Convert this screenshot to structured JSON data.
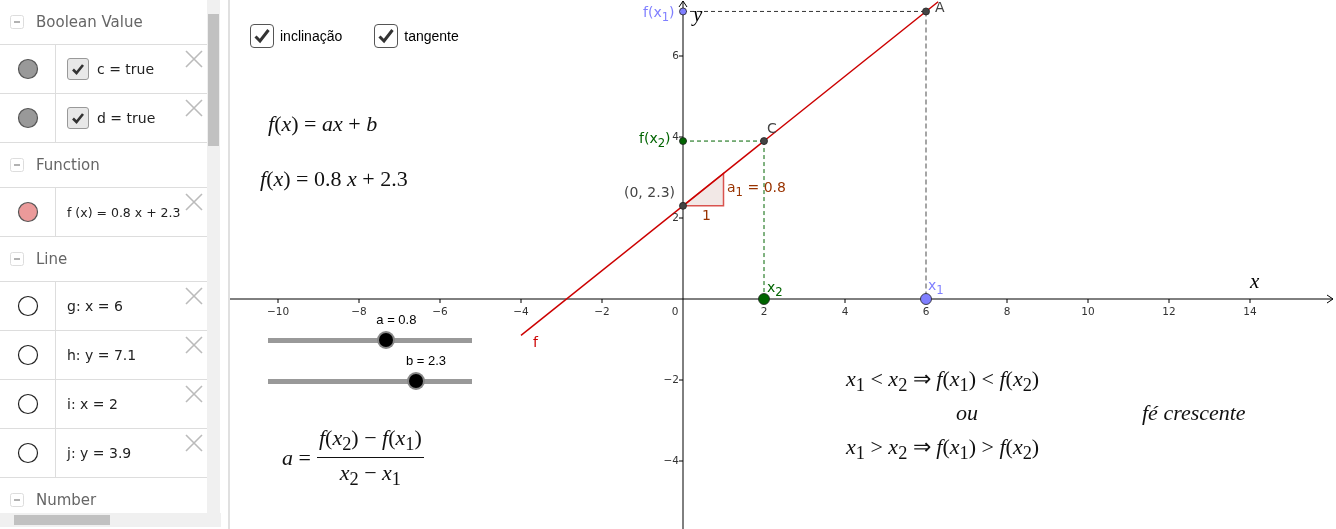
{
  "algebra_view": {
    "groups": [
      {
        "header": "Boolean Value",
        "expanded": true,
        "items": [
          {
            "kind": "checkbox",
            "visible": true,
            "color": "#999999",
            "checked": true,
            "text": "c = true"
          },
          {
            "kind": "checkbox",
            "visible": true,
            "color": "#999999",
            "checked": true,
            "text": "d = true"
          }
        ]
      },
      {
        "header": "Function",
        "expanded": true,
        "items": [
          {
            "kind": "text",
            "visible": true,
            "color": "#eb9a9a",
            "text": "f (x) = 0.8 x + 2.3"
          }
        ]
      },
      {
        "header": "Line",
        "expanded": true,
        "items": [
          {
            "kind": "text",
            "visible": false,
            "text": "g: x = 6"
          },
          {
            "kind": "text",
            "visible": false,
            "text": "h: y = 7.1"
          },
          {
            "kind": "text",
            "visible": false,
            "text": "i: x = 2"
          },
          {
            "kind": "text",
            "visible": false,
            "text": "j: y = 3.9"
          }
        ]
      },
      {
        "header": "Number",
        "expanded": true
      }
    ]
  },
  "graphics": {
    "checkboxes": [
      {
        "label": "inclinação",
        "checked": true
      },
      {
        "label": "tangente",
        "checked": true
      }
    ],
    "formula_general": "*f*(*x*) = *ax* + *b*",
    "formula_specific": "*f*(*x*) = 0.8 *x* + 2.3",
    "sliders": [
      {
        "label": "a = 0.8",
        "level": 0.58
      },
      {
        "label": "b = 2.3",
        "level": 0.725
      }
    ],
    "slope_formula": {
      "lhs": "*a* =",
      "numerator": "*f*(*x*$_{2}$) − *f*(*x*$_{1}$)",
      "denominator": "*x*$_{2}$ − *x*$_{1}$"
    },
    "monotonic_note": {
      "line_1": "*x*$_{1}$ < *x*$_{2}$ ⇒ *f*(*x*$_{1}$) < *f*(*x*$_{2}$)",
      "or": "ou",
      "conclusion": "fé crescente",
      "line_2": "*x*$_{1}$ > *x*$_{2}$ ⇒ *f*(*x*$_{1}$) > *f*(*x*$_{2}$)"
    },
    "x_axis": {
      "label": "x",
      "tick_labels": [
        "−10",
        "−8",
        "−6",
        "−4",
        "−2",
        "0",
        "2",
        "4",
        "6",
        "8",
        "10",
        "12",
        "14"
      ]
    },
    "y_axis": {
      "label": "y",
      "tick_labels": [
        "6",
        "4",
        "2",
        "−2",
        "−4"
      ]
    },
    "function_line": {
      "color": "#cc0000"
    },
    "points": [
      {
        "color": "#7f7fff"
      },
      {
        "color": "#444444"
      },
      {
        "color": "#444444"
      },
      {
        "color": "#006400"
      },
      {
        "color": "#444444"
      },
      {
        "color": "#006400"
      },
      {
        "color": "#7f7fff"
      }
    ],
    "labels": [
      {
        "text": "f(x$_{1}$)",
        "color": "#7f7fff"
      },
      {
        "text": "A",
        "color": "#444444"
      },
      {
        "text": "C",
        "color": "#444444"
      },
      {
        "text": "f(x$_{2}$)",
        "color": "#006400"
      },
      {
        "text": "(0, 2.3)",
        "color": "#444444"
      },
      {
        "text": "a$_{1}$ = 0.8",
        "color": "#993300"
      },
      {
        "text": "1",
        "color": "#993300"
      },
      {
        "text": "x$_{2}$",
        "color": "#006400"
      },
      {
        "text": "x$_{1}$",
        "color": "#7f7fff"
      },
      {
        "text": "f",
        "color": "#cc0000"
      }
    ]
  }
}
